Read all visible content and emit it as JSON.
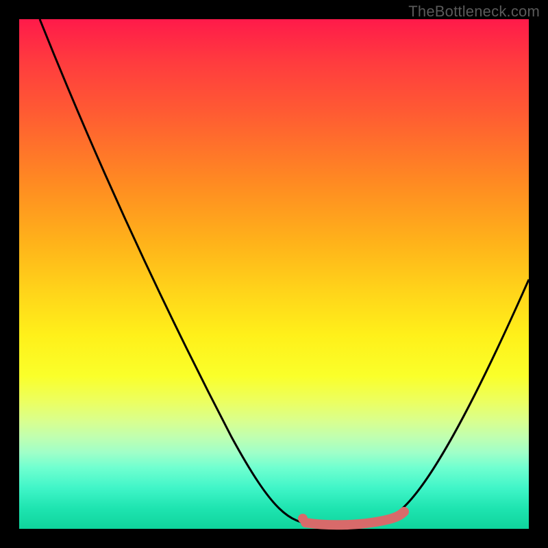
{
  "watermark": "TheBottleneck.com",
  "chart_data": {
    "type": "line",
    "title": "",
    "xlabel": "",
    "ylabel": "",
    "xlim": [
      0,
      100
    ],
    "ylim": [
      0,
      100
    ],
    "series": [
      {
        "name": "bottleneck-curve",
        "x": [
          4,
          10,
          20,
          30,
          40,
          50,
          56,
          60,
          65,
          70,
          75,
          82,
          90,
          100
        ],
        "y": [
          100,
          85,
          62,
          42,
          24,
          10,
          2,
          1,
          0.5,
          1,
          3,
          10,
          28,
          49
        ]
      },
      {
        "name": "highlight-range",
        "x": [
          56,
          60,
          65,
          70,
          74,
          76
        ],
        "y": [
          1.5,
          1,
          0.5,
          1,
          2,
          3
        ]
      }
    ],
    "annotations": [],
    "legend": false,
    "grid": false,
    "background_gradient": {
      "top": "#ff1a4a",
      "middle": "#ffe01a",
      "bottom": "#0fd49c"
    },
    "highlight_color": "#d86a6a",
    "curve_color": "#000000"
  }
}
